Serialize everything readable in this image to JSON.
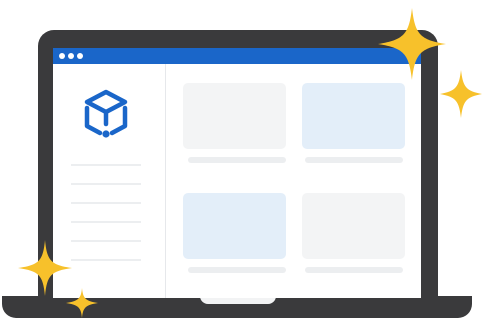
{
  "illustration": {
    "window_dots": [
      "dot",
      "dot",
      "dot"
    ],
    "logo_icon": "cube-app-logo-icon",
    "sparkle_icon": "four-point-star-icon",
    "colors": {
      "bezel": "#3a3a3c",
      "titlebar": "#1a66c9",
      "logo": "#1a66c9",
      "card_gray": "#f3f4f5",
      "card_blue": "#e3eef9",
      "placeholder_line": "#eceef0",
      "sparkle": "#f7c12b"
    },
    "cards": [
      {
        "tone": "gray"
      },
      {
        "tone": "blue"
      },
      {
        "tone": "blue"
      },
      {
        "tone": "gray"
      }
    ]
  }
}
